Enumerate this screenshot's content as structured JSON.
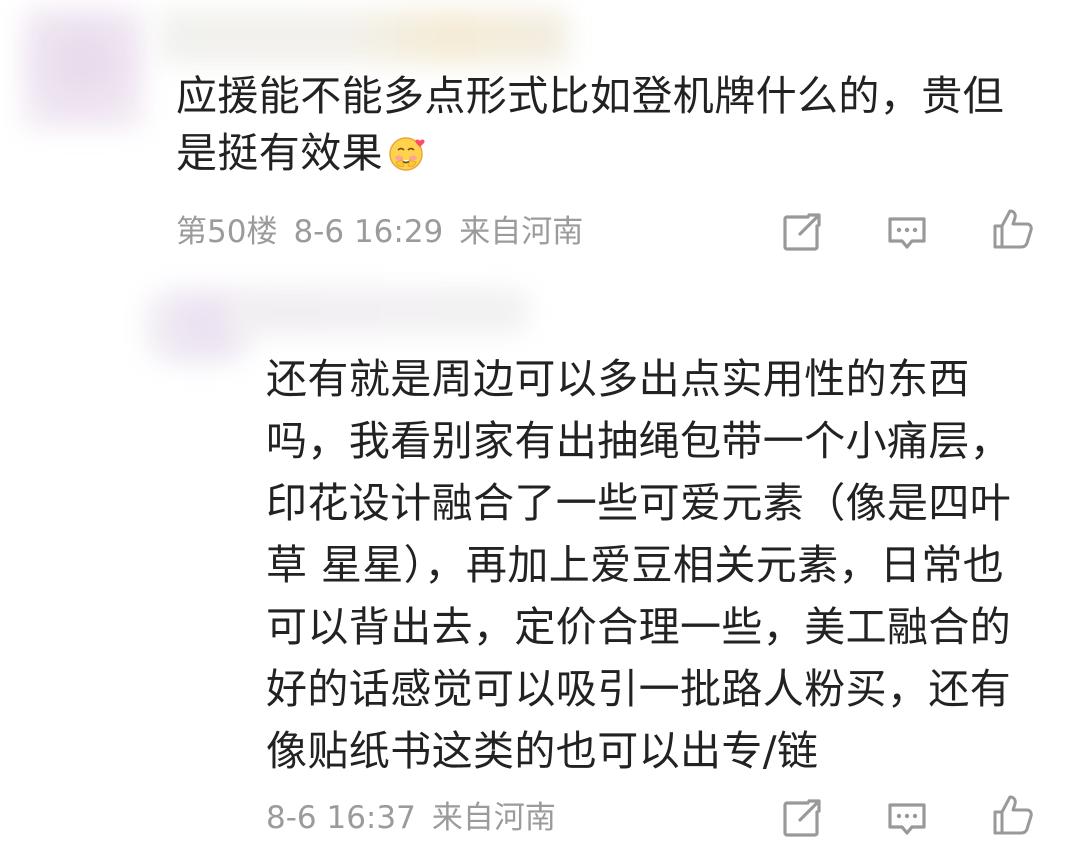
{
  "comments": [
    {
      "text_line1": "应援能不能多点形式比如登机牌什么的，贵但",
      "text_line2": "是挺有效果",
      "emoji": "blushing-smile-emoji",
      "floor": "第50楼",
      "time": "8-6 16:29",
      "location": "来自河南"
    },
    {
      "text": "还有就是周边可以多出点实用性的东西\n吗，我看别家有出抽绳包带一个小痛层，\n印花设计融合了一些可爱元素（像是四叶\n草 星星），再加上爱豆相关元素，日常也\n可以背出去，定价合理一些，美工融合的\n好的话感觉可以吸引一批路人粉买，还有\n像贴纸书这类的也可以出专/链",
      "time": "8-6 16:37",
      "location": "来自河南"
    }
  ],
  "icons": {
    "share": "share-icon",
    "reply": "comment-icon",
    "like": "thumbs-up-icon"
  },
  "colors": {
    "text": "#222222",
    "meta": "#9b9b9b",
    "icon": "#999999"
  }
}
